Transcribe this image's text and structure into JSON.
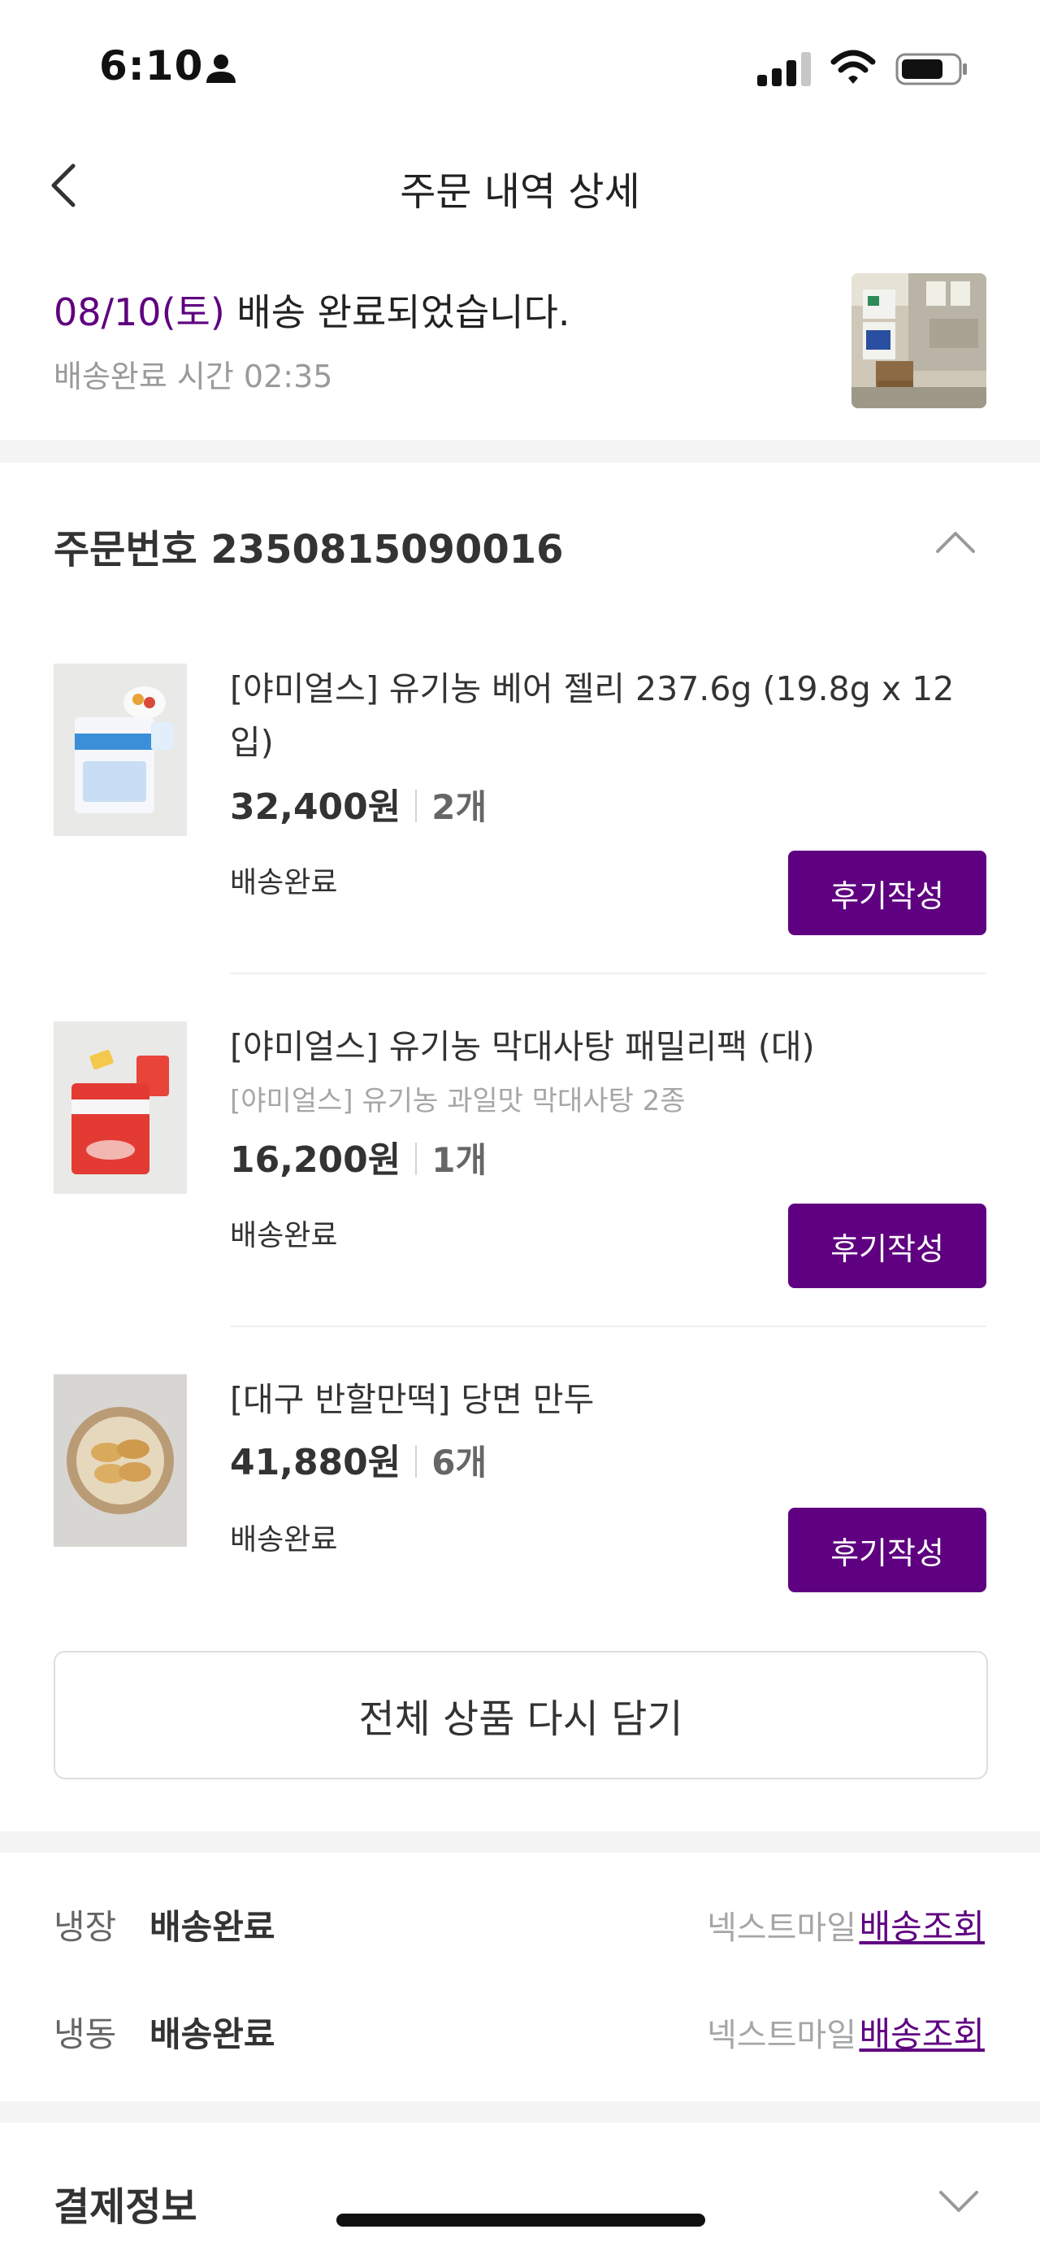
{
  "status_bar": {
    "time": "6:10"
  },
  "header": {
    "title": "주문 내역 상세"
  },
  "delivery": {
    "date": "08/10(토)",
    "message": " 배송 완료되었습니다.",
    "time_label": "배송완료 시간 02:35"
  },
  "order": {
    "number_label": "주문번호 2350815090016",
    "items": [
      {
        "name": "[야미얼스] 유기농 베어 젤리 237.6g (19.8g x 12입)",
        "price": "32,400원",
        "qty": "2개",
        "status": "배송완료",
        "review_label": "후기작성"
      },
      {
        "name": "[야미얼스] 유기농 막대사탕 패밀리팩 (대)",
        "option": "[야미얼스] 유기농 과일맛 막대사탕 2종",
        "price": "16,200원",
        "qty": "1개",
        "status": "배송완료",
        "review_label": "후기작성"
      },
      {
        "name": "[대구 반할만떡] 당면 만두",
        "price": "41,880원",
        "qty": "6개",
        "status": "배송완료",
        "review_label": "후기작성"
      }
    ],
    "reorder_label": "전체 상품 다시 담기"
  },
  "shipping": [
    {
      "type": "냉장",
      "status": "배송완료",
      "carrier": "넥스트마일",
      "track_label": "배송조회"
    },
    {
      "type": "냉동",
      "status": "배송완료",
      "carrier": "넥스트마일",
      "track_label": "배송조회"
    }
  ],
  "payment": {
    "title": "결제정보"
  },
  "colors": {
    "accent": "#5f0080",
    "divider": "#f4f4f4"
  },
  "icons": [
    "person-icon",
    "signal-icon",
    "wifi-icon",
    "battery-icon",
    "back-chevron-icon",
    "chevron-up-icon",
    "chevron-down-icon"
  ]
}
